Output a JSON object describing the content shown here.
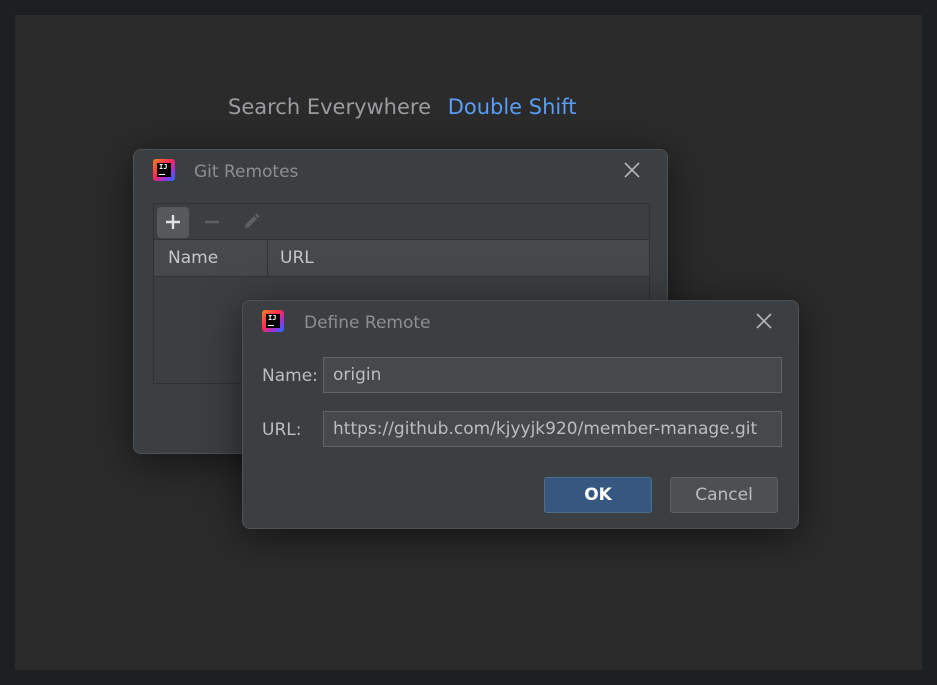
{
  "hint": {
    "label": "Search Everywhere",
    "shortcut": "Double Shift"
  },
  "git_remotes_dialog": {
    "title": "Git Remotes",
    "toolbar": {
      "add_icon": "plus-icon",
      "remove_icon": "minus-icon",
      "edit_icon": "pencil-icon"
    },
    "columns": [
      "Name",
      "URL"
    ],
    "rows": []
  },
  "define_remote_dialog": {
    "title": "Define Remote",
    "name_label": "Name:",
    "name_value": "origin",
    "url_label": "URL:",
    "url_value": "https://github.com/kjyyjk920/member-manage.git",
    "ok_label": "OK",
    "cancel_label": "Cancel"
  },
  "colors": {
    "accent": "#589df6",
    "ok_button": "#365880",
    "dialog_bg": "#3c3f41"
  }
}
